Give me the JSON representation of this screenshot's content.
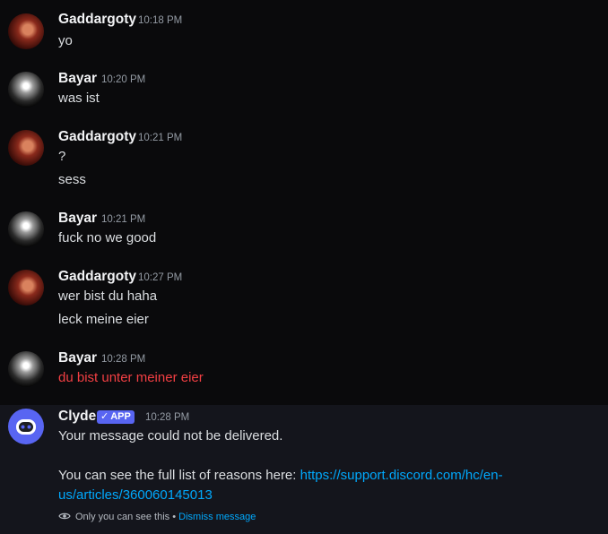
{
  "messages": [
    {
      "author": "Gaddargoty",
      "time": "10:18 PM",
      "lines": [
        "yo"
      ]
    },
    {
      "author": "Bayar",
      "time": "10:20 PM",
      "lines": [
        "was ist"
      ]
    },
    {
      "author": "Gaddargoty",
      "time": "10:21 PM",
      "lines": [
        "?",
        "sess"
      ]
    },
    {
      "author": "Bayar",
      "time": "10:21 PM",
      "lines": [
        "fuck no we good"
      ]
    },
    {
      "author": "Gaddargoty",
      "time": "10:27 PM",
      "lines": [
        "wer bist du haha",
        "leck meine eier"
      ]
    },
    {
      "author": "Bayar",
      "time": "10:28 PM",
      "lines": [
        "du bist unter meiner eier"
      ],
      "line_color": "#f23f43"
    }
  ],
  "clyde": {
    "author": "Clyde",
    "badge_check": "✓",
    "badge": "APP",
    "time": "10:28 PM",
    "line1": "Your message could not be delivered.",
    "line2_prefix": "You can see the full list of reasons here: ",
    "link_part1": "https://support.discord.com/hc/en-",
    "link_part2": "us/articles/360060145013",
    "footer_text": "Only you can see this",
    "footer_sep": " • ",
    "dismiss": "Dismiss message"
  },
  "colors": {
    "background": "#0a0a0c",
    "clyde_background": "#14151c",
    "link": "#00a8fc",
    "error_text": "#f23f43",
    "app_badge": "#5865f2"
  },
  "icons": {
    "avatar_gaddargoty": "user-avatar-icon",
    "avatar_bayar": "user-avatar-icon",
    "avatar_clyde": "clyde-bot-icon",
    "footer_eye": "eye-icon",
    "badge_check": "check-icon"
  }
}
